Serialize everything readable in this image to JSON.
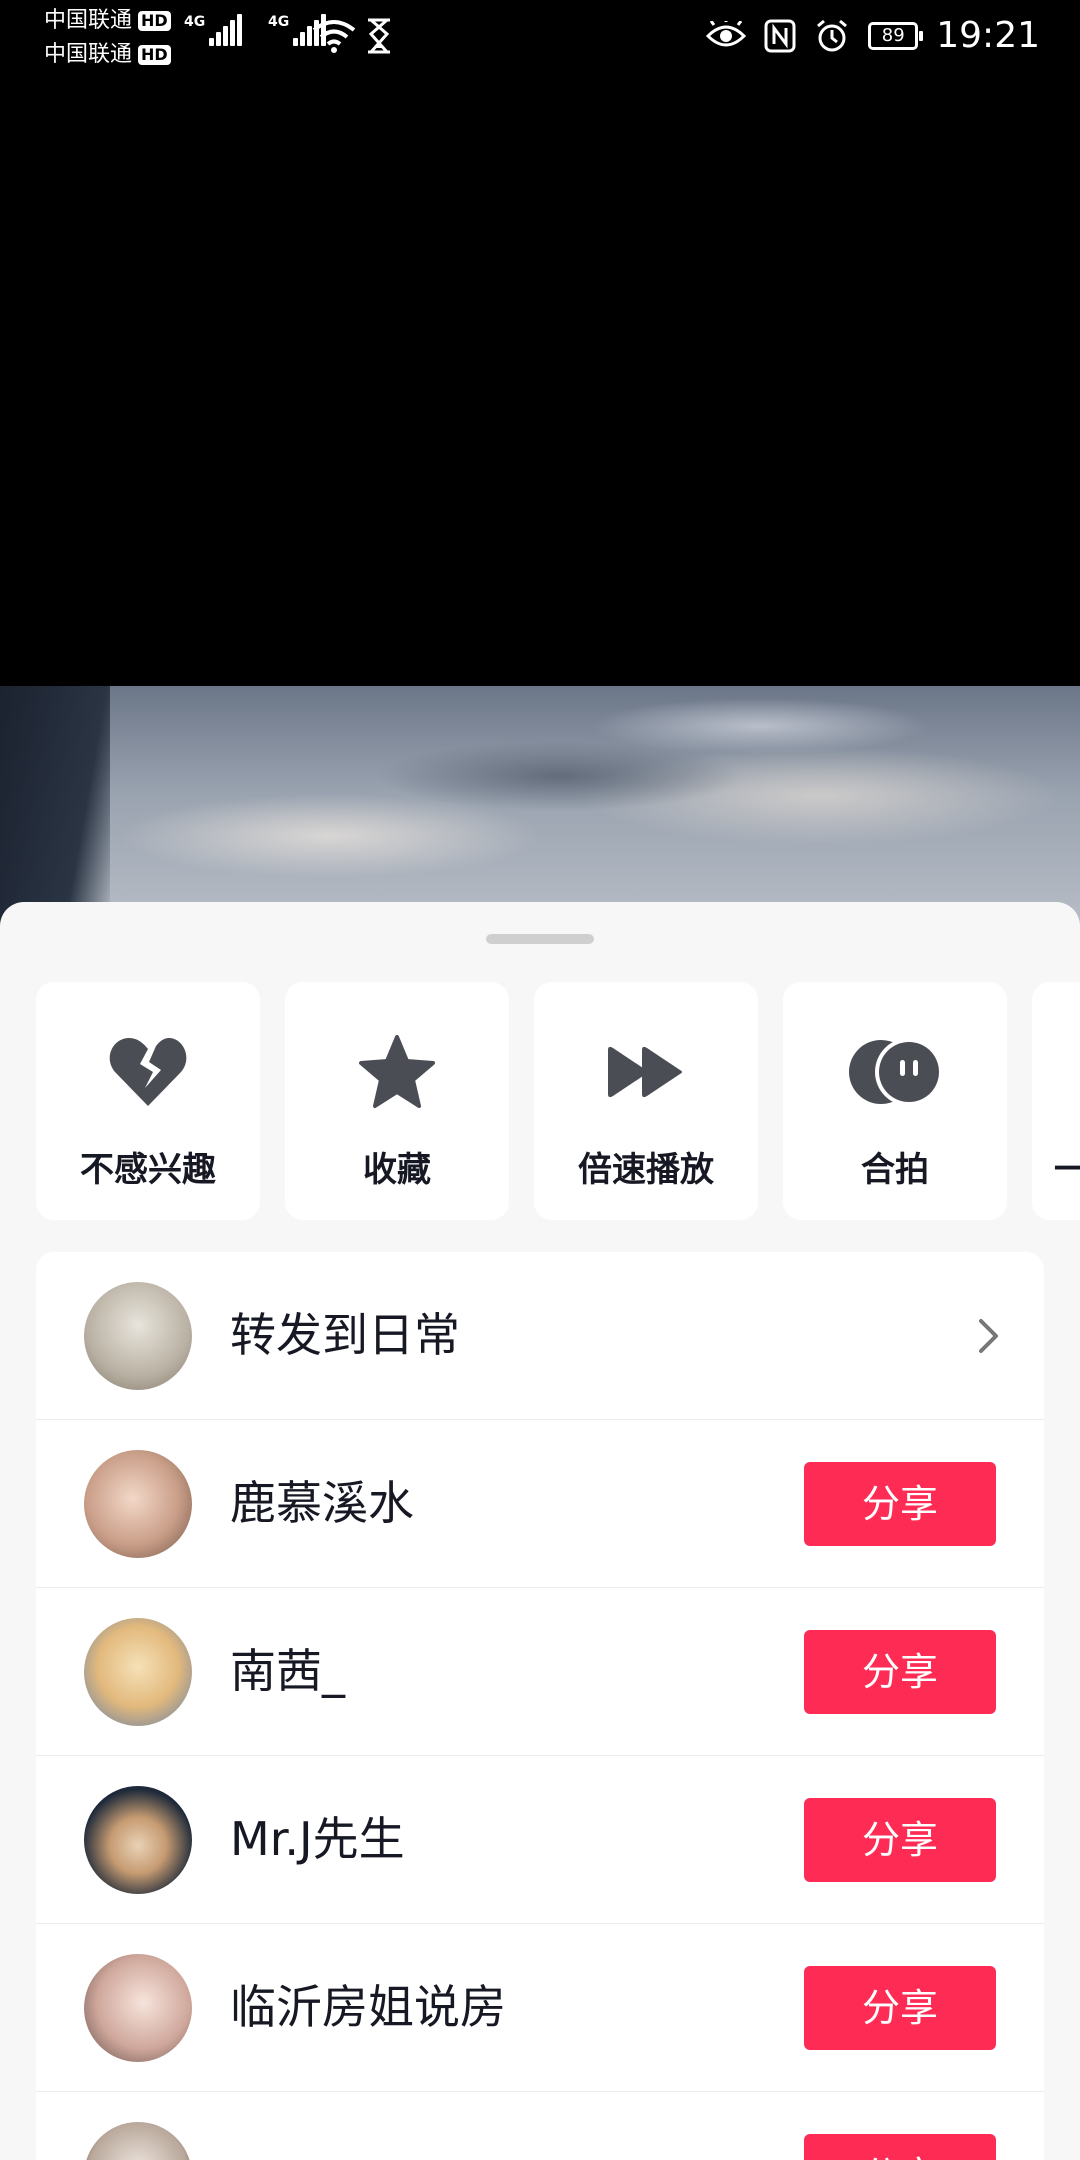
{
  "status_bar": {
    "carrier_1": "中国联通",
    "carrier_2": "中国联通",
    "hd_badge": "HD",
    "network_1": "4G",
    "network_2": "4G",
    "battery": "89",
    "time": "19:21",
    "icons": [
      "eye-icon",
      "nfc-icon",
      "alarm-icon",
      "battery-icon",
      "wifi-icon",
      "hourglass-icon"
    ]
  },
  "actions": [
    {
      "label": "不感兴趣",
      "icon": "broken-heart-icon"
    },
    {
      "label": "收藏",
      "icon": "star-icon"
    },
    {
      "label": "倍速播放",
      "icon": "fast-forward-icon"
    },
    {
      "label": "合拍",
      "icon": "duet-icon"
    },
    {
      "label": "一",
      "icon": ""
    }
  ],
  "share_list": {
    "repost": {
      "label": "转发到日常",
      "icon": "chevron-right-icon"
    },
    "contacts": [
      {
        "name": "鹿慕溪水",
        "button": "分享"
      },
      {
        "name": "南茜_",
        "button": "分享"
      },
      {
        "name": "Mr.J先生",
        "button": "分享"
      },
      {
        "name": "临沂房姐说房",
        "button": "分享"
      },
      {
        "name": "",
        "button": "分享"
      }
    ]
  },
  "colors": {
    "accent": "#fe2c55",
    "sheet_bg": "#f7f7f7",
    "icon": "#4b4d55"
  }
}
